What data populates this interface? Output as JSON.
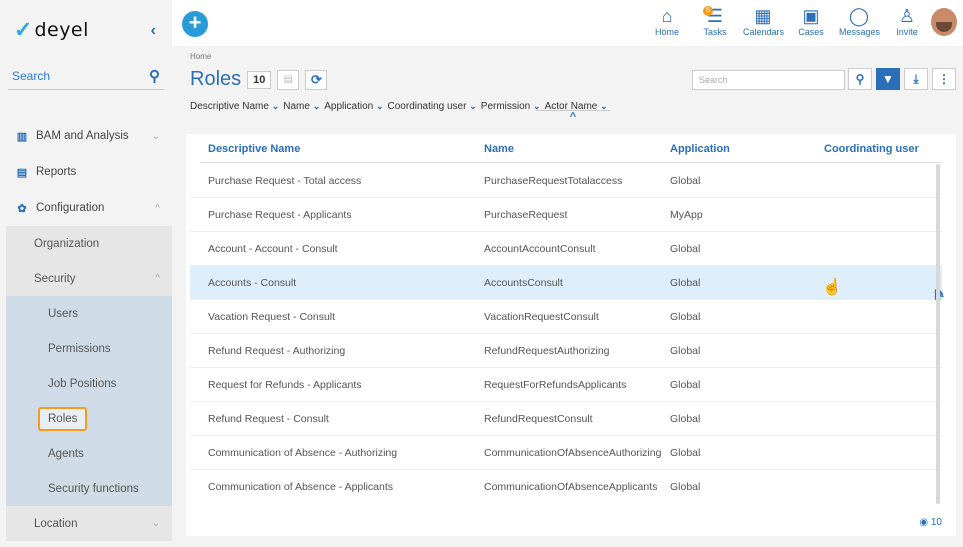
{
  "brand": {
    "name": "deyel"
  },
  "sidebar": {
    "search_placeholder": "Search",
    "items": [
      {
        "label": "BAM and Analysis",
        "icon": "chart-icon"
      },
      {
        "label": "Reports",
        "icon": "report-icon"
      },
      {
        "label": "Configuration",
        "icon": "gear-icon"
      },
      {
        "label": "Organization"
      },
      {
        "label": "Security"
      },
      {
        "label": "Users"
      },
      {
        "label": "Permissions"
      },
      {
        "label": "Job Positions"
      },
      {
        "label": "Roles"
      },
      {
        "label": "Agents"
      },
      {
        "label": "Security functions"
      },
      {
        "label": "Location"
      }
    ]
  },
  "topnav": [
    {
      "label": "Home",
      "icon": "home-icon"
    },
    {
      "label": "Tasks",
      "icon": "tasks-icon",
      "badge": "5"
    },
    {
      "label": "Calendars",
      "icon": "calendar-icon"
    },
    {
      "label": "Cases",
      "icon": "briefcase-icon"
    },
    {
      "label": "Messages",
      "icon": "chat-icon"
    },
    {
      "label": "Invite",
      "icon": "invite-icon"
    }
  ],
  "page": {
    "breadcrumb": "Home",
    "title": "Roles",
    "count": "10",
    "search_placeholder": "Search",
    "column_filters": [
      "Descriptive Name",
      "Name",
      "Application",
      "Coordinating user",
      "Permission",
      "Actor Name"
    ],
    "footer_count": "10"
  },
  "table": {
    "headers": [
      "Descriptive Name",
      "Name",
      "Application",
      "Coordinating user"
    ],
    "rows": [
      [
        "Purchase Request - Total access",
        "PurchaseRequestTotalaccess",
        "Global",
        ""
      ],
      [
        "Purchase Request - Applicants",
        "PurchaseRequest",
        "MyApp",
        ""
      ],
      [
        "Account - Account - Consult",
        "AccountAccountConsult",
        "Global",
        ""
      ],
      [
        "Accounts - Consult",
        "AccountsConsult",
        "Global",
        ""
      ],
      [
        "Vacation Request - Consult",
        "VacationRequestConsult",
        "Global",
        ""
      ],
      [
        "Refund Request - Authorizing",
        "RefundRequestAuthorizing",
        "Global",
        ""
      ],
      [
        "Request for Refunds - Applicants",
        "RequestForRefundsApplicants",
        "Global",
        ""
      ],
      [
        "Refund Request - Consult",
        "RefundRequestConsult",
        "Global",
        ""
      ],
      [
        "Communication of Absence - Authorizing",
        "CommunicationOfAbsenceAuthorizing",
        "Global",
        ""
      ],
      [
        "Communication of Absence - Applicants",
        "CommunicationOfAbsenceApplicants",
        "Global",
        ""
      ]
    ]
  },
  "colors": {
    "accent": "#2a6fb8",
    "highlight": "#f39c22",
    "add": "#2a9bd8"
  }
}
